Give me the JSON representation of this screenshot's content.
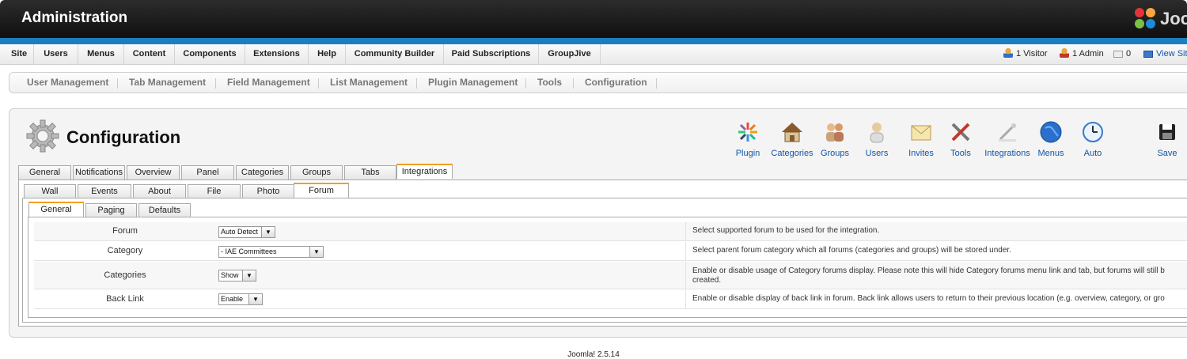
{
  "header": {
    "title": "Administration",
    "logo_text": "Joo"
  },
  "menu": {
    "items": [
      "Site",
      "Users",
      "Menus",
      "Content",
      "Components",
      "Extensions",
      "Help",
      "Community Builder",
      "Paid Subscriptions",
      "GroupJive"
    ]
  },
  "status": {
    "visitors": "1 Visitor",
    "admins": "1 Admin",
    "messages": "0",
    "view_site": "View Site"
  },
  "submenu": {
    "items": [
      "User Management",
      "Tab Management",
      "Field Management",
      "List Management",
      "Plugin Management",
      "Tools",
      "Configuration"
    ]
  },
  "page": {
    "title": "Configuration"
  },
  "toolbar": {
    "buttons": [
      "Plugin",
      "Categories",
      "Groups",
      "Users",
      "Invites",
      "Tools",
      "Integrations",
      "Menus",
      "Auto",
      "Save"
    ]
  },
  "tabs_level1": {
    "items": [
      "General",
      "Notifications",
      "Overview",
      "Panel",
      "Categories",
      "Groups",
      "Tabs",
      "Integrations"
    ],
    "active": "Integrations"
  },
  "tabs_level2": {
    "items": [
      "Wall",
      "Events",
      "About",
      "File",
      "Photo",
      "Forum"
    ],
    "active": "Forum"
  },
  "tabs_level3": {
    "items": [
      "General",
      "Paging",
      "Defaults"
    ],
    "active": "General"
  },
  "settings": [
    {
      "label": "Forum",
      "value": "Auto Detect",
      "description": "Select supported forum to be used for the integration."
    },
    {
      "label": "Category",
      "value": "- IAE Committees",
      "description": "Select parent forum category which all forums (categories and groups) will be stored under."
    },
    {
      "label": "Categories",
      "value": "Show",
      "description": "Enable or disable usage of Category forums display. Please note this will hide Category forums menu link and tab, but forums will still b",
      "description2": "created."
    },
    {
      "label": "Back Link",
      "value": "Enable",
      "description": "Enable or disable display of back link in forum. Back link allows users to return to their previous location (e.g. overview, category, or gro"
    }
  ],
  "footer": {
    "version": "Joomla! 2.5.14"
  },
  "colors": {
    "accent_blue": "#1b7ec0",
    "active_tab": "#f0a020",
    "link": "#1155aa"
  }
}
